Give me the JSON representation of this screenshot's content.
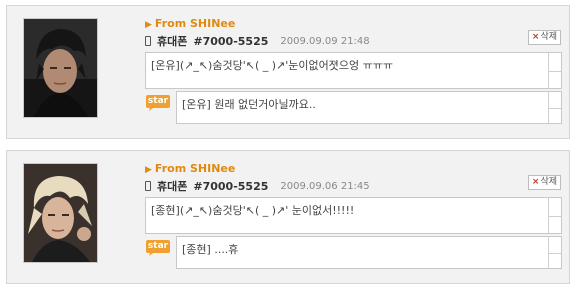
{
  "entries": [
    {
      "from": "From SHINee",
      "sender": "휴대폰",
      "number": "#7000-5525",
      "date": "2009.09.09 21:48",
      "delete_label": "삭제",
      "message": "[온유](↗_↖)숨것당'↖( _ )↗'눈이없어졋으엉 ㅠㅠㅠ",
      "star_label": "star",
      "reply": "[온유] 원래 없던거아닐까요..",
      "colors": {
        "hair": "#1a1a1a",
        "bg": "#2a2a2a",
        "skin": "#b89178"
      }
    },
    {
      "from": "From SHINee",
      "sender": "휴대폰",
      "number": "#7000-5525",
      "date": "2009.09.06 21:45",
      "delete_label": "삭제",
      "message": "[종현](↗_↖)숨것당'↖( _ )↗' 눈이없서!!!!!",
      "star_label": "star",
      "reply": "[종현] ....휴",
      "colors": {
        "hair": "#e8dcc0",
        "bg": "#3a3230",
        "skin": "#d9b8a0"
      }
    }
  ],
  "theme": {
    "accent": "#e08a10",
    "star_badge": "#f0a030",
    "delete_x": "#c0392b"
  }
}
